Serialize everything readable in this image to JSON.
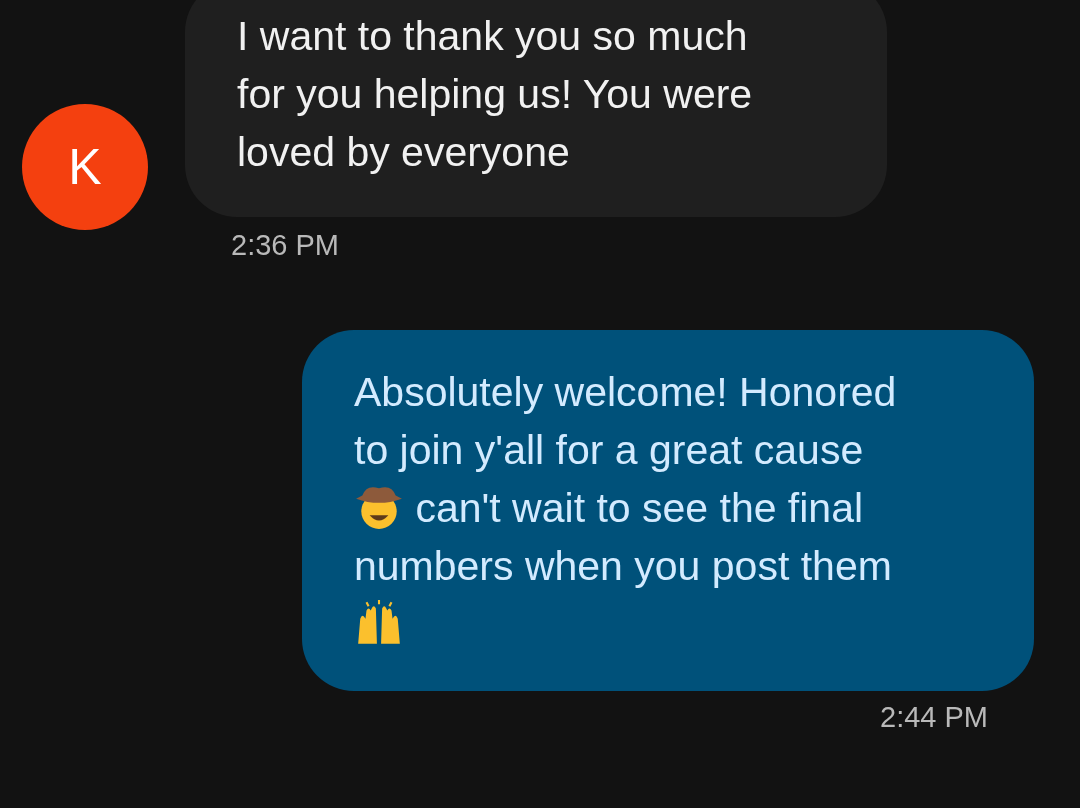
{
  "messages": [
    {
      "kind": "incoming",
      "avatar": "K",
      "parts": [
        {
          "kind": "text",
          "text": "I want to thank you so much\nfor you helping us! You were\nloved by everyone"
        }
      ],
      "time": "2:36 PM"
    },
    {
      "kind": "outgoing",
      "parts": [
        {
          "kind": "text",
          "text": "Absolutely welcome! Honored\nto join y'all for a great cause\n"
        },
        {
          "kind": "cowboy-emoji"
        },
        {
          "kind": "text",
          "text": " can't wait to see the final\nnumbers when you post them\n"
        },
        {
          "kind": "raised-hands-emoji"
        }
      ],
      "time": "2:44 PM"
    }
  ]
}
